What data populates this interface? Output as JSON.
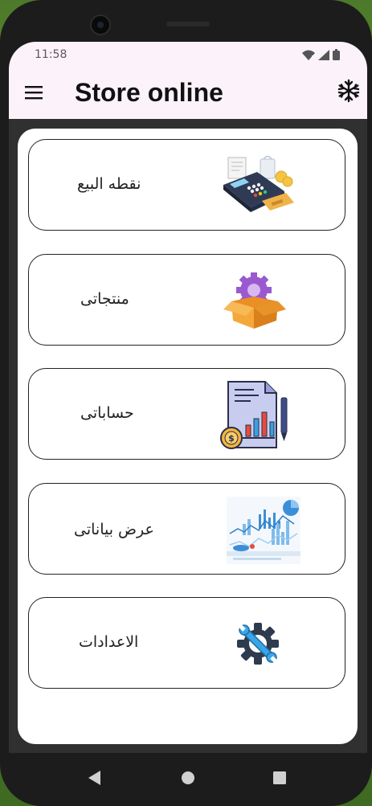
{
  "status_bar": {
    "time": "11:58"
  },
  "app_bar": {
    "title": "Store online"
  },
  "menu_items": [
    {
      "label": "نقطه البيع",
      "icon": "pos-terminal-icon"
    },
    {
      "label": "منتجاتى",
      "icon": "product-box-icon"
    },
    {
      "label": "حساباتى",
      "icon": "accounts-report-icon"
    },
    {
      "label": "عرض بياناتى",
      "icon": "data-charts-icon"
    },
    {
      "label": "الاعدادات",
      "icon": "settings-gear-icon"
    }
  ]
}
